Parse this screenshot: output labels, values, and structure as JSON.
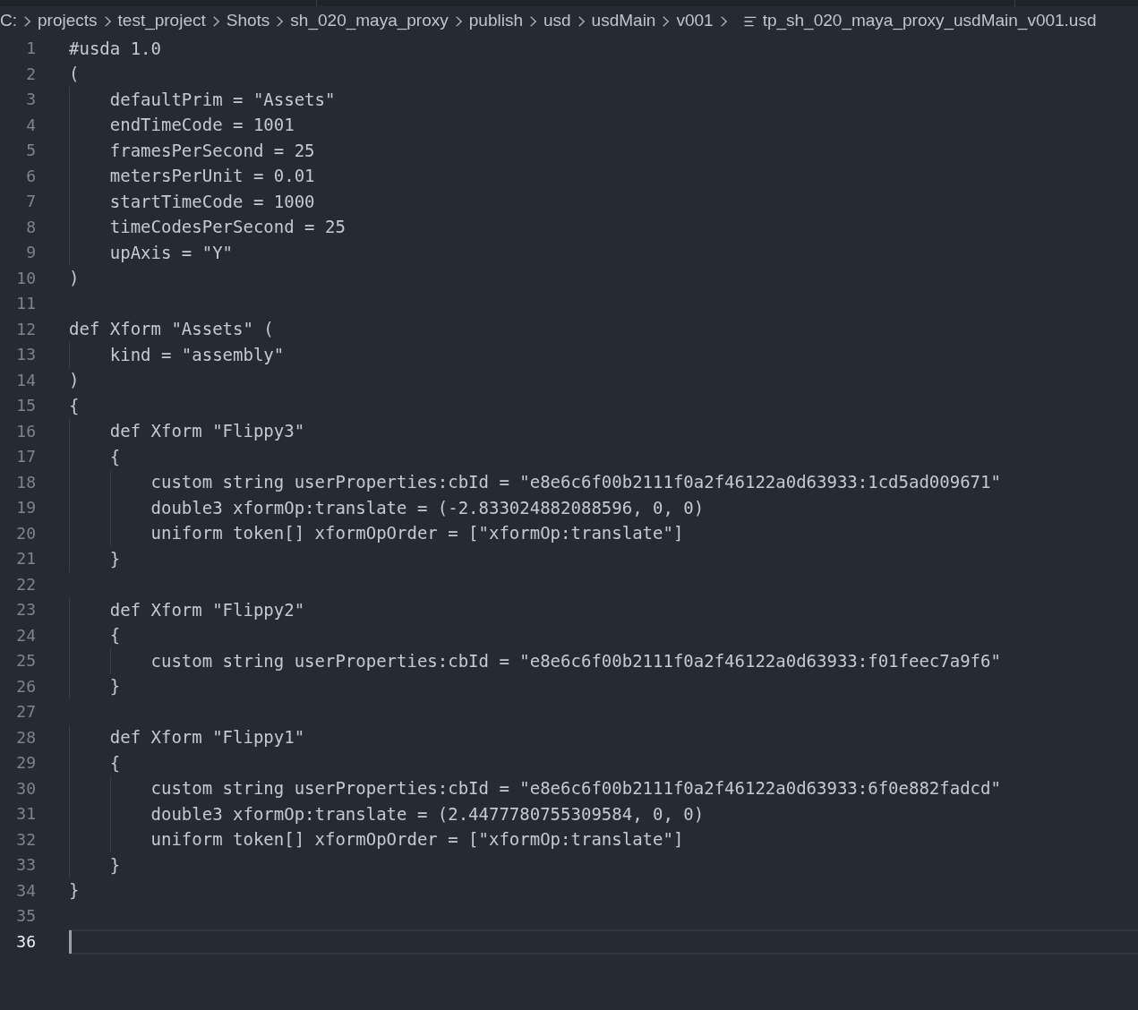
{
  "breadcrumb": {
    "segments": [
      "C:",
      "projects",
      "test_project",
      "Shots",
      "sh_020_maya_proxy",
      "publish",
      "usd",
      "usdMain",
      "v001"
    ],
    "file": "tp_sh_020_maya_proxy_usdMain_v001.usd"
  },
  "editor": {
    "lines": [
      {
        "number": "1",
        "text": "#usda 1.0",
        "selected": false
      },
      {
        "number": "2",
        "text": "(",
        "selected": false
      },
      {
        "number": "3",
        "text": "    defaultPrim = \"Assets\"",
        "selected": false
      },
      {
        "number": "4",
        "text": "    endTimeCode = 1001",
        "selected": false
      },
      {
        "number": "5",
        "text": "    framesPerSecond = 25",
        "selected": false
      },
      {
        "number": "6",
        "text": "    metersPerUnit = 0.01",
        "selected": false
      },
      {
        "number": "7",
        "text": "    startTimeCode = 1000",
        "selected": false
      },
      {
        "number": "8",
        "text": "    timeCodesPerSecond = 25",
        "selected": false
      },
      {
        "number": "9",
        "text": "    upAxis = \"Y\"",
        "selected": false
      },
      {
        "number": "10",
        "text": ")",
        "selected": false
      },
      {
        "number": "11",
        "selected": false
      },
      {
        "number": "12",
        "text": "def Xform \"Assets\" (",
        "selected": false
      },
      {
        "number": "13",
        "text": "    kind = \"assembly\"",
        "selected": false
      },
      {
        "number": "14",
        "text": ")",
        "selected": false
      },
      {
        "number": "15",
        "text": "{",
        "selected": false
      },
      {
        "number": "16",
        "text": "    def Xform \"Flippy3\"",
        "selected": false
      },
      {
        "number": "17",
        "text": "    {",
        "selected": false
      },
      {
        "number": "18",
        "text": "        custom string userProperties:cbId = \"e8e6c6f00b2111f0a2f46122a0d63933:1cd5ad009671\"",
        "selected": false
      },
      {
        "number": "19",
        "text": "        double3 xformOp:translate = (-2.833024882088596, 0, 0)",
        "selected": false
      },
      {
        "number": "20",
        "text": "        uniform token[] xformOpOrder = [\"xformOp:translate\"]",
        "selected": false
      },
      {
        "number": "21",
        "text": "    }",
        "selected": false
      },
      {
        "number": "22",
        "selected": false
      },
      {
        "number": "23",
        "text": "    def Xform \"Flippy2\"",
        "selected": false
      },
      {
        "number": "24",
        "text": "    {",
        "selected": false
      },
      {
        "number": "25",
        "text": "        custom string userProperties:cbId = \"e8e6c6f00b2111f0a2f46122a0d63933:f01feec7a9f6\"",
        "selected": false
      },
      {
        "number": "26",
        "text": "    }",
        "selected": false
      },
      {
        "number": "27",
        "selected": false
      },
      {
        "number": "28",
        "text": "    def Xform \"Flippy1\"",
        "selected": false
      },
      {
        "number": "29",
        "text": "    {",
        "selected": false
      },
      {
        "number": "30",
        "text": "        custom string userProperties:cbId = \"e8e6c6f00b2111f0a2f46122a0d63933:6f0e882fadcd\"",
        "selected": false
      },
      {
        "number": "31",
        "text": "        double3 xformOp:translate = (2.4477780755309584, 0, 0)",
        "selected": false
      },
      {
        "number": "32",
        "text": "        uniform token[] xformOpOrder = [\"xformOp:translate\"]",
        "selected": false
      },
      {
        "number": "33",
        "text": "    }",
        "selected": false
      },
      {
        "number": "34",
        "text": "}",
        "selected": false
      },
      {
        "number": "35",
        "selected": false
      },
      {
        "number": "36",
        "selected": true
      }
    ]
  }
}
